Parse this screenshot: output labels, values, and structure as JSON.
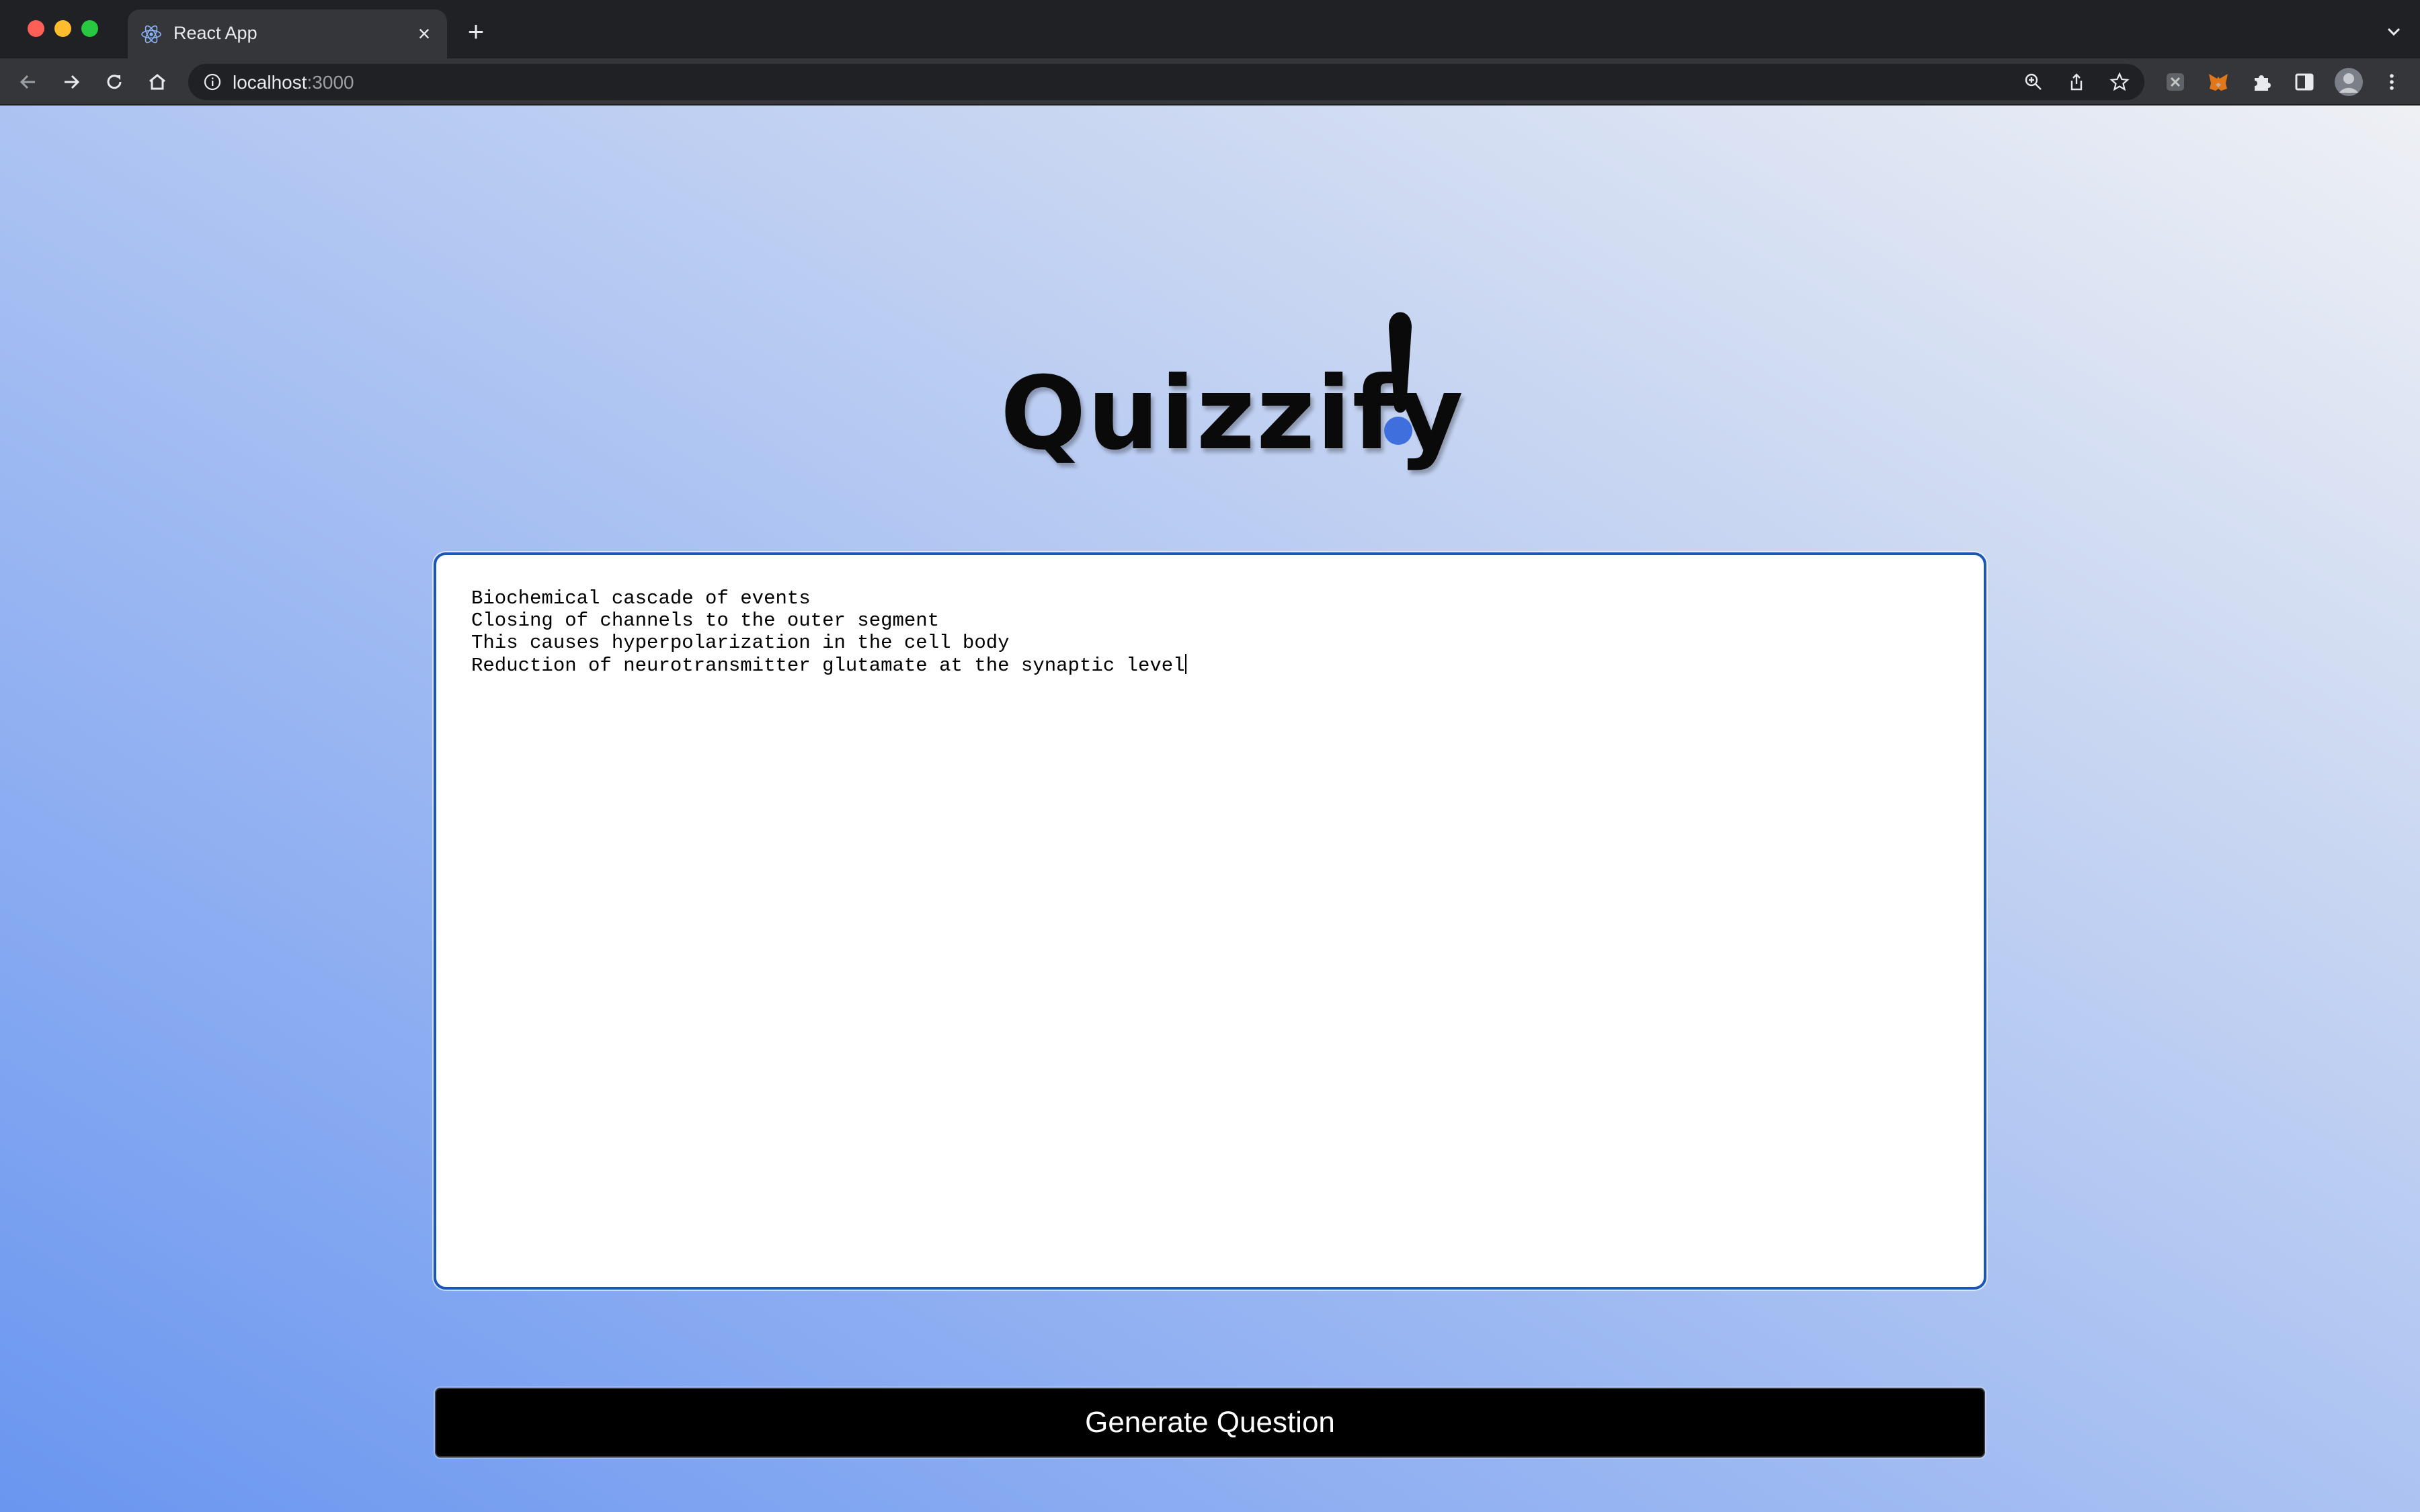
{
  "browser": {
    "tab_title": "React App",
    "tab_close_icon": "close-icon",
    "new_tab_icon": "plus-icon",
    "url_host": "localhost",
    "url_port": ":3000",
    "toolbar_icons": [
      "back-arrow-icon",
      "forward-arrow-icon",
      "reload-icon",
      "home-icon",
      "info-icon",
      "zoom-icon",
      "share-icon",
      "star-icon",
      "extension-icon",
      "metamask-fox-icon",
      "puzzle-icon",
      "side-panel-icon",
      "profile-avatar-icon",
      "more-vert-icon"
    ]
  },
  "app": {
    "logo_text": "Quizzify",
    "logo_accent": "!",
    "accent_color": "#3f6fdc",
    "notes": {
      "lines": [
        "Biochemical cascade of events",
        "Closing of channels to the outer segment",
        "This causes hyperpolarization in the cell body",
        "Reduction of neurotransmitter glutamate at the synaptic level"
      ]
    },
    "generate_label": "Generate Question"
  }
}
